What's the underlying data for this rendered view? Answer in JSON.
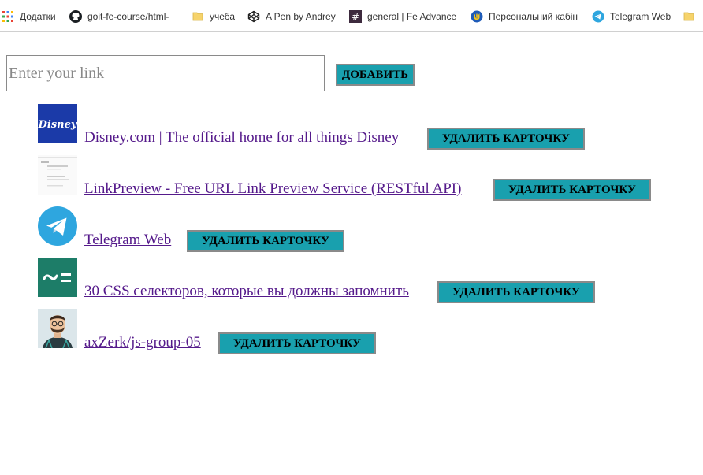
{
  "bookmarks_bar": {
    "items": [
      {
        "label": "Додатки",
        "icon": "apps-grid-icon"
      },
      {
        "label": "goit-fe-course/html-",
        "icon": "github-icon"
      },
      {
        "label": "учеба",
        "icon": "folder-icon"
      },
      {
        "label": "A Pen by Andrey",
        "icon": "codepen-icon"
      },
      {
        "label": "general | Fe Advance",
        "icon": "slack-hash-icon"
      },
      {
        "label": "Персональний кабін",
        "icon": "trident-icon"
      },
      {
        "label": "Telegram Web",
        "icon": "telegram-icon"
      },
      {
        "label": "",
        "icon": "folder-icon"
      }
    ]
  },
  "form": {
    "input_placeholder": "Enter your link",
    "input_value": "",
    "add_button_label": "ДОБАВИТЬ"
  },
  "cards": [
    {
      "title": "Disney.com | The official home for all things Disney",
      "thumb": "disney-logo",
      "delete_label": "УДАЛИТЬ КАРТОЧКУ"
    },
    {
      "title": "LinkPreview - Free URL Link Preview Service (RESTful API)",
      "thumb": "page-screenshot",
      "delete_label": "УДАЛИТЬ КАРТОЧКУ"
    },
    {
      "title": "Telegram Web",
      "thumb": "telegram-logo",
      "delete_label": "УДАЛИТЬ КАРТОЧКУ"
    },
    {
      "title": "30 CSS селекторов, которые вы должны запомнить",
      "thumb": "tutsplus-logo",
      "delete_label": "УДАЛИТЬ КАРТОЧКУ"
    },
    {
      "title": "axZerk/js-group-05",
      "thumb": "github-avatar",
      "delete_label": "УДАЛИТЬ КАРТОЧКУ"
    }
  ],
  "colors": {
    "button_bg": "#19a0ae",
    "link_visited": "#551a8b",
    "disney_bg": "#1b3aa8",
    "telegram_blue": "#2ea6df",
    "tutsplus_green": "#1d7d68"
  }
}
